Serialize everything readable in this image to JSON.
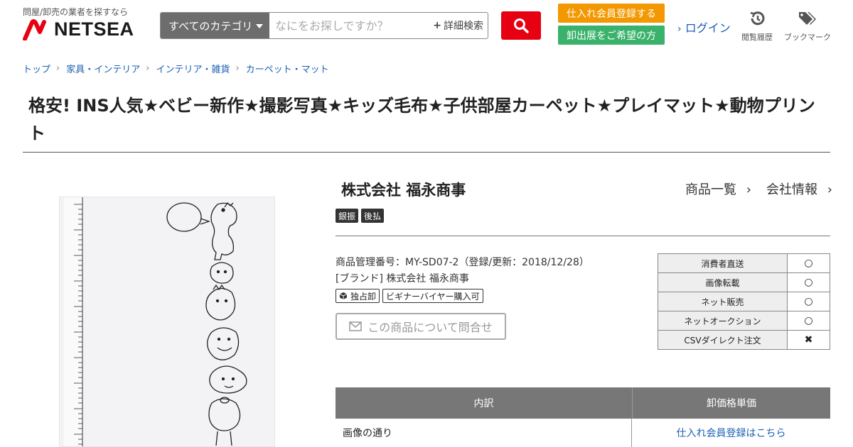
{
  "header": {
    "tagline": "問屋/卸売の業者を探すなら",
    "logo_text": "NETSEA",
    "category_label": "すべてのカテゴリ",
    "search_placeholder": "なにをお探しですか？",
    "advanced_search": "詳細検索",
    "register_button": "仕入れ会員登録する",
    "exhibit_button": "卸出展をご希望の方",
    "login": "ログイン",
    "history_label": "閲覧履歴",
    "bookmark_label": "ブックマーク",
    "brand_color": "#e60012",
    "register_color": "#f39800",
    "exhibit_color": "#3ab26b"
  },
  "breadcrumb": [
    "トップ",
    "家具・インテリア",
    "インテリア・雑貨",
    "カーペット・マット"
  ],
  "product": {
    "title": "格安! INS人気★ベビー新作★撮影写真★キッズ毛布★子供部屋カーペット★プレイマット★動物プリント",
    "image_alt": "身長計柄 動物プリント ブランケット"
  },
  "company": {
    "name": "株式会社 福永商事",
    "product_list_link": "商品一覧",
    "company_info_link": "会社情報",
    "badges": [
      "銀振",
      "後払"
    ]
  },
  "details": {
    "management_no": "商品管理番号：MY-SD07-2（登録/更新：2018/12/28）",
    "brand": "[ブランド] 株式会社 福永商事",
    "tags": [
      "独占卸",
      "ビギナーバイヤー購入可"
    ],
    "inquiry_button": "この商品について問合せ"
  },
  "permissions": [
    {
      "label": "消費者直送",
      "value": "○"
    },
    {
      "label": "画像転載",
      "value": "○"
    },
    {
      "label": "ネット販売",
      "value": "○"
    },
    {
      "label": "ネットオークション",
      "value": "○"
    },
    {
      "label": "CSVダイレクト注文",
      "value": "✖"
    }
  ],
  "price_table": {
    "headers": [
      "内訳",
      "卸価格単価"
    ],
    "rows": [
      {
        "item": "画像の通り",
        "price": "仕入れ会員登録はこちら"
      }
    ]
  }
}
